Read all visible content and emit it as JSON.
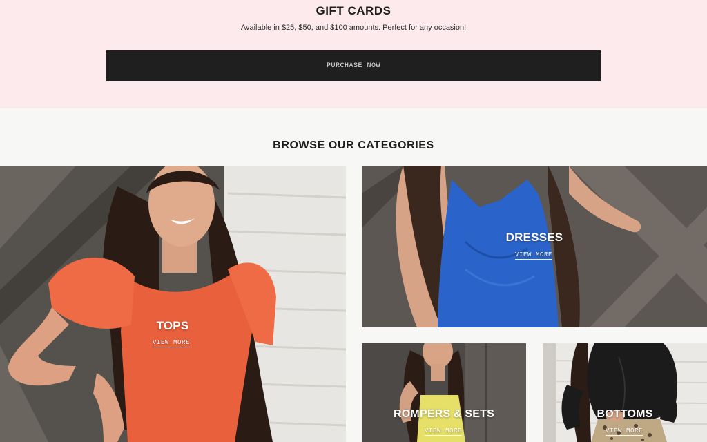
{
  "gift_cards": {
    "title": "GIFT CARDS",
    "subtitle": "Available in $25, $50, and $100 amounts. Perfect for any occasion!",
    "button_label": "PURCHASE NOW"
  },
  "categories_section": {
    "title": "BROWSE OUR CATEGORIES",
    "tiles": [
      {
        "name": "TOPS",
        "link": "VIEW MORE"
      },
      {
        "name": "DRESSES",
        "link": "VIEW MORE"
      },
      {
        "name": "ROMPERS & SETS",
        "link": "VIEW MORE"
      },
      {
        "name": "BOTTOMS",
        "link": "VIEW MORE"
      }
    ]
  },
  "colors": {
    "gift_background": "#fdeaec",
    "button": "#1f1f1f",
    "page_background": "#f7f7f5"
  }
}
